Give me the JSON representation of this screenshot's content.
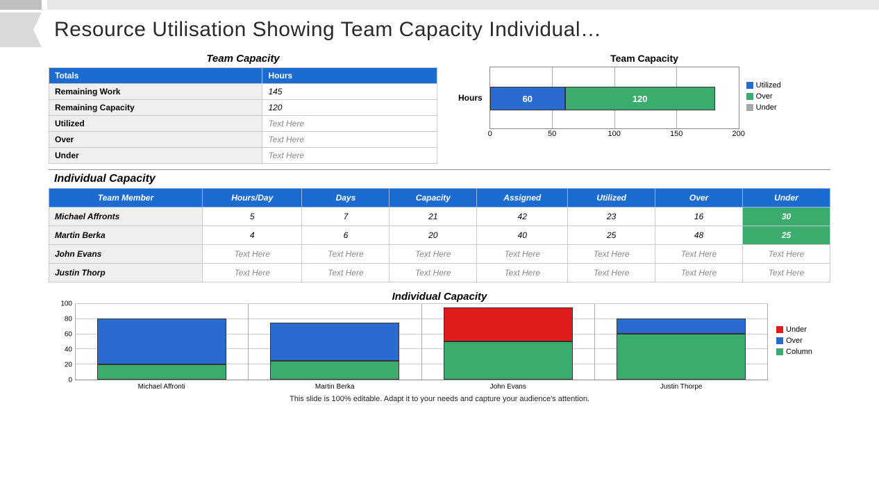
{
  "title": "Resource Utilisation Showing Team Capacity Individual…",
  "team_capacity": {
    "title": "Team Capacity",
    "headers": {
      "c1": "Totals",
      "c2": "Hours"
    },
    "rows": [
      {
        "label": "Remaining Work",
        "value": "145"
      },
      {
        "label": "Remaining Capacity",
        "value": "120"
      },
      {
        "label": "Utilized",
        "value": "Text Here"
      },
      {
        "label": "Over",
        "value": "Text Here"
      },
      {
        "label": "Under",
        "value": "Text Here"
      }
    ]
  },
  "team_chart": {
    "title": "Team Capacity",
    "ylabel": "Hours",
    "legend": [
      "Utilized",
      "Over",
      "Under"
    ],
    "xticks": [
      "0",
      "50",
      "100",
      "150",
      "200"
    ]
  },
  "individual": {
    "title": "Individual Capacity",
    "headers": [
      "Team Member",
      "Hours/Day",
      "Days",
      "Capacity",
      "Assigned",
      "Utilized",
      "Over",
      "Under"
    ],
    "rows": [
      {
        "name": "Michael Affronts",
        "c1": "5",
        "c2": "7",
        "c3": "21",
        "c4": "42",
        "c5": "23",
        "c6": "16",
        "c7": "30"
      },
      {
        "name": "Martin Berka",
        "c1": "4",
        "c2": "6",
        "c3": "20",
        "c4": "40",
        "c5": "25",
        "c6": "48",
        "c7": "25"
      },
      {
        "name": "John Evans",
        "c1": "Text Here",
        "c2": "Text Here",
        "c3": "Text Here",
        "c4": "Text Here",
        "c5": "Text Here",
        "c6": "Text Here",
        "c7": "Text Here"
      },
      {
        "name": "Justin Thorp",
        "c1": "Text Here",
        "c2": "Text Here",
        "c3": "Text Here",
        "c4": "Text Here",
        "c5": "Text Here",
        "c6": "Text Here",
        "c7": "Text Here"
      }
    ]
  },
  "indiv_chart": {
    "title": "Individual Capacity",
    "yticks": [
      "0",
      "20",
      "40",
      "60",
      "80",
      "100"
    ],
    "legend": [
      "Under",
      "Over",
      "Column"
    ],
    "categories": [
      "Michael Affronti",
      "Martin Berka",
      "John Evans",
      "Justin Thorpe"
    ]
  },
  "footer": "This slide is 100% editable. Adapt it to your needs and capture your audience's attention.",
  "chart_data": [
    {
      "type": "bar",
      "orientation": "horizontal_stacked",
      "title": "Team Capacity",
      "ylabel": "Hours",
      "categories": [
        "Hours"
      ],
      "series": [
        {
          "name": "Utilized",
          "values": [
            60
          ],
          "color": "#2a6bd1"
        },
        {
          "name": "Over",
          "values": [
            120
          ],
          "color": "#3cab6e"
        },
        {
          "name": "Under",
          "values": [
            0
          ],
          "color": "#a8a8a8"
        }
      ],
      "xlim": [
        0,
        200
      ],
      "xticks": [
        0,
        50,
        100,
        150,
        200
      ]
    },
    {
      "type": "bar",
      "orientation": "vertical_stacked",
      "title": "Individual Capacity",
      "categories": [
        "Michael Affronti",
        "Martin Berka",
        "John Evans",
        "Justin Thorpe"
      ],
      "series": [
        {
          "name": "Column",
          "values": [
            20,
            25,
            50,
            60
          ],
          "color": "#3cab6e"
        },
        {
          "name": "Over",
          "values": [
            60,
            50,
            0,
            20
          ],
          "color": "#2a6bd1"
        },
        {
          "name": "Under",
          "values": [
            0,
            0,
            45,
            0
          ],
          "color": "#e01b1b"
        }
      ],
      "ylim": [
        0,
        100
      ],
      "yticks": [
        0,
        20,
        40,
        60,
        80,
        100
      ]
    }
  ]
}
